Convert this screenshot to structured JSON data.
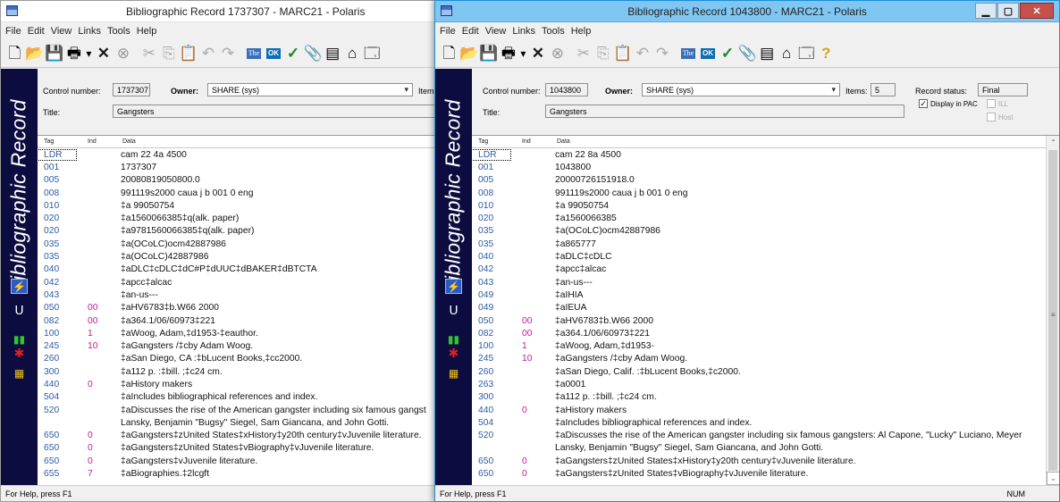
{
  "colors": {
    "tag": "#2a5ca8",
    "indicator": "#c8189a",
    "sidebar": "#0c0c40",
    "active_title": "#7fc6f3"
  },
  "menu": [
    "File",
    "Edit",
    "View",
    "Links",
    "Tools",
    "Help"
  ],
  "sidebar_label": "Bibliographic Record",
  "grid_headers": {
    "tag": "Tag",
    "ind": "Ind",
    "data": "Data"
  },
  "windows": [
    {
      "title": "Bibliographic Record 1737307 - MARC21 - Polaris",
      "control_number_label": "Control number:",
      "control_number": "1737307",
      "owner_label": "Owner:",
      "owner": "SHARE (sys)",
      "items_label": "Items:",
      "title_label": "Title:",
      "title_value": "Gangsters",
      "status_text": "For Help, press F1",
      "records": [
        {
          "tag": "LDR",
          "ind": "",
          "data": "     cam  22    4a 4500"
        },
        {
          "tag": "001",
          "ind": "",
          "data": "1737307"
        },
        {
          "tag": "005",
          "ind": "",
          "data": "20080819050800.0"
        },
        {
          "tag": "008",
          "ind": "",
          "data": "991119s2000   caua  j b    001 0 eng"
        },
        {
          "tag": "010",
          "ind": "",
          "data": "‡a   99050754"
        },
        {
          "tag": "020",
          "ind": "",
          "data": "‡a1560066385‡q(alk. paper)"
        },
        {
          "tag": "020",
          "ind": "",
          "data": "‡a9781560066385‡q(alk. paper)"
        },
        {
          "tag": "035",
          "ind": "",
          "data": "‡a(OCoLC)ocm42887986"
        },
        {
          "tag": "035",
          "ind": "",
          "data": "‡a(OCoLC)42887986"
        },
        {
          "tag": "040",
          "ind": "",
          "data": "‡aDLC‡cDLC‡dC#P‡dUUC‡dBAKER‡dBTCTA"
        },
        {
          "tag": "042",
          "ind": "",
          "data": "‡apcc‡alcac"
        },
        {
          "tag": "043",
          "ind": "",
          "data": "‡an-us---"
        },
        {
          "tag": "050",
          "ind": "00",
          "data": "‡aHV6783‡b.W66 2000"
        },
        {
          "tag": "082",
          "ind": "00",
          "data": "‡a364.1/06/60973‡221"
        },
        {
          "tag": "100",
          "ind": "1",
          "data": "‡aWoog, Adam,‡d1953-‡eauthor."
        },
        {
          "tag": "245",
          "ind": "10",
          "data": "‡aGangsters /‡cby Adam Woog."
        },
        {
          "tag": "260",
          "ind": "",
          "data": "‡aSan Diego, CA :‡bLucent Books,‡cc2000."
        },
        {
          "tag": "300",
          "ind": "",
          "data": "‡a112 p. :‡bill. ;‡c24 cm."
        },
        {
          "tag": "440",
          "ind": "0",
          "data": "‡aHistory makers"
        },
        {
          "tag": "504",
          "ind": "",
          "data": "‡aIncludes bibliographical references and index."
        },
        {
          "tag": "520",
          "ind": "",
          "data": "‡aDiscusses the rise of the American gangster including six famous gangst"
        },
        {
          "tag": "",
          "ind": "",
          "data": "Lansky, Benjamin \"Bugsy\" Siegel, Sam Giancana, and John Gotti."
        },
        {
          "tag": "650",
          "ind": "0",
          "data": "‡aGangsters‡zUnited States‡xHistory‡y20th century‡vJuvenile literature."
        },
        {
          "tag": "650",
          "ind": "0",
          "data": "‡aGangsters‡zUnited States‡vBiography‡vJuvenile literature."
        },
        {
          "tag": "650",
          "ind": "0",
          "data": "‡aGangsters‡vJuvenile literature."
        },
        {
          "tag": "655",
          "ind": "7",
          "data": "‡aBiographies.‡2lcgft"
        }
      ]
    },
    {
      "title": "Bibliographic Record 1043800 - MARC21 - Polaris",
      "control_number_label": "Control number:",
      "control_number": "1043800",
      "owner_label": "Owner:",
      "owner": "SHARE (sys)",
      "items_label": "Items:",
      "items": "5",
      "record_status_label": "Record status:",
      "record_status": "Final",
      "title_label": "Title:",
      "title_value": "Gangsters",
      "display_in_pac_label": "Display in PAC",
      "ill_label": "ILL",
      "host_label": "Host",
      "status_text": "For Help, press F1",
      "num_indicator": "NUM",
      "records": [
        {
          "tag": "LDR",
          "ind": "",
          "data": "     cam  22    8a 4500"
        },
        {
          "tag": "001",
          "ind": "",
          "data": "1043800"
        },
        {
          "tag": "005",
          "ind": "",
          "data": "20000726151918.0"
        },
        {
          "tag": "008",
          "ind": "",
          "data": "991119s2000   caua  j b    001 0 eng"
        },
        {
          "tag": "010",
          "ind": "",
          "data": "‡a   99050754"
        },
        {
          "tag": "020",
          "ind": "",
          "data": "‡a1560066385"
        },
        {
          "tag": "035",
          "ind": "",
          "data": "‡a(OCoLC)ocm42887986"
        },
        {
          "tag": "035",
          "ind": "",
          "data": "‡a865777"
        },
        {
          "tag": "040",
          "ind": "",
          "data": "‡aDLC‡cDLC"
        },
        {
          "tag": "042",
          "ind": "",
          "data": "‡apcc‡alcac"
        },
        {
          "tag": "043",
          "ind": "",
          "data": "‡an-us---"
        },
        {
          "tag": "049",
          "ind": "",
          "data": "‡aIHIA"
        },
        {
          "tag": "049",
          "ind": "",
          "data": "‡aIEUA"
        },
        {
          "tag": "050",
          "ind": "00",
          "data": "‡aHV6783‡b.W66 2000"
        },
        {
          "tag": "082",
          "ind": "00",
          "data": "‡a364.1/06/60973‡221"
        },
        {
          "tag": "100",
          "ind": "1",
          "data": "‡aWoog, Adam,‡d1953-"
        },
        {
          "tag": "245",
          "ind": "10",
          "data": "‡aGangsters /‡cby Adam Woog."
        },
        {
          "tag": "260",
          "ind": "",
          "data": "‡aSan Diego, Calif. :‡bLucent Books,‡c2000."
        },
        {
          "tag": "263",
          "ind": "",
          "data": "‡a0001"
        },
        {
          "tag": "300",
          "ind": "",
          "data": "‡a112 p. :‡bill. ;‡c24 cm."
        },
        {
          "tag": "440",
          "ind": "0",
          "data": "‡aHistory makers"
        },
        {
          "tag": "504",
          "ind": "",
          "data": "‡aIncludes bibliographical references and index."
        },
        {
          "tag": "520",
          "ind": "",
          "data": "‡aDiscusses the rise of the American gangster including six famous gangsters: Al Capone, \"Lucky\" Luciano, Meyer"
        },
        {
          "tag": "",
          "ind": "",
          "data": "Lansky, Benjamin \"Bugsy\" Siegel, Sam Giancana, and John Gotti."
        },
        {
          "tag": "650",
          "ind": "0",
          "data": "‡aGangsters‡zUnited States‡xHistory‡y20th century‡vJuvenile literature."
        },
        {
          "tag": "650",
          "ind": "0",
          "data": "‡aGangsters‡zUnited States‡vBiography‡vJuvenile literature."
        }
      ]
    }
  ]
}
